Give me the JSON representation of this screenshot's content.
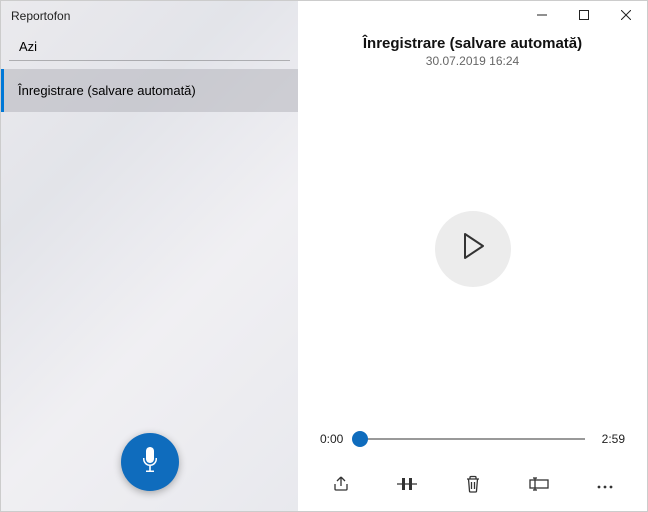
{
  "app": {
    "title": "Reportofon"
  },
  "sidebar": {
    "group_label": "Azi",
    "items": [
      {
        "label": "Înregistrare (salvare automată)"
      }
    ]
  },
  "main": {
    "title": "Înregistrare (salvare automată)",
    "subtitle": "30.07.2019 16:24",
    "time_current": "0:00",
    "time_total": "2:59"
  },
  "icons": {
    "share": "share-icon",
    "trim": "trim-icon",
    "delete": "delete-icon",
    "rename": "rename-icon",
    "more": "more-icon"
  }
}
